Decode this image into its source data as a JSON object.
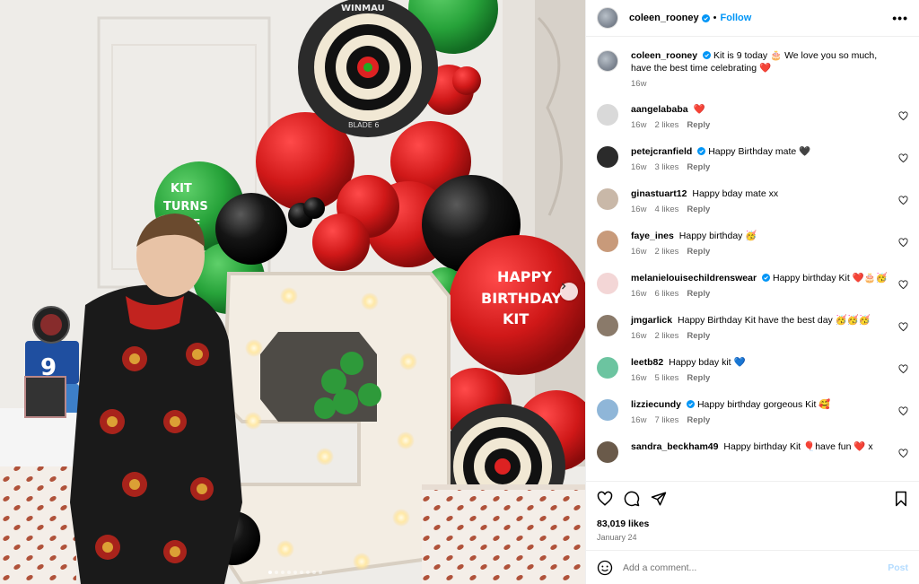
{
  "post": {
    "author": "coleen_rooney",
    "follow_label": "Follow",
    "separator": "•",
    "more_label": "•••",
    "caption_text": "Kit is 9 today 🎂 We love you so much, have the best time celebrating ❤️",
    "caption_time": "16w",
    "likes": "83,019 likes",
    "date": "January 24"
  },
  "photo": {
    "balloon_text_green": [
      "KIT",
      "TURNS",
      "NINE"
    ],
    "balloon_text_red": [
      "HAPPY",
      "BIRTHDAY",
      "KIT"
    ],
    "dartboard_brand": "WINMAU",
    "dartboard_model": "BLADE 6",
    "cake_number": "9",
    "big_number": "9",
    "carousel_dots": 9,
    "active_dot": 0
  },
  "comments": [
    {
      "user": "aangelababa",
      "verified": false,
      "text": "❤️",
      "time": "16w",
      "likes": "2 likes",
      "reply": "Reply",
      "avatar_color": "#d9d9d9"
    },
    {
      "user": "petejcranfield",
      "verified": true,
      "text": "Happy Birthday mate 🖤",
      "time": "16w",
      "likes": "3 likes",
      "reply": "Reply",
      "avatar_color": "#2b2b2b"
    },
    {
      "user": "ginastuart12",
      "verified": false,
      "text": "Happy bday mate xx",
      "time": "16w",
      "likes": "4 likes",
      "reply": "Reply",
      "avatar_color": "#c9b8a8"
    },
    {
      "user": "faye_ines",
      "verified": false,
      "text": "Happy birthday 🥳",
      "time": "16w",
      "likes": "2 likes",
      "reply": "Reply",
      "avatar_color": "#c89a7a"
    },
    {
      "user": "melanielouisechildrenswear",
      "verified": true,
      "text": "Happy birthday Kit ❤️🎂🥳",
      "time": "16w",
      "likes": "6 likes",
      "reply": "Reply",
      "avatar_color": "#f3d6d6"
    },
    {
      "user": "jmgarlick",
      "verified": false,
      "text": "Happy Birthday Kit have the best day 🥳🥳🥳",
      "time": "16w",
      "likes": "2 likes",
      "reply": "Reply",
      "avatar_color": "#8a7a6a"
    },
    {
      "user": "leetb82",
      "verified": false,
      "text": "Happy bday kit 💙",
      "time": "16w",
      "likes": "5 likes",
      "reply": "Reply",
      "avatar_color": "#6cc4a0"
    },
    {
      "user": "lizziecundy",
      "verified": true,
      "text": "Happy birthday gorgeous Kit 🥰",
      "time": "16w",
      "likes": "7 likes",
      "reply": "Reply",
      "avatar_color": "#8fb6d8"
    },
    {
      "user": "sandra_beckham49",
      "verified": false,
      "text": "Happy birthday Kit 🎈have fun ❤️ x",
      "time": "",
      "likes": "",
      "reply": "",
      "avatar_color": "#6a5a4a"
    }
  ],
  "composer": {
    "placeholder": "Add a comment...",
    "post_label": "Post"
  },
  "colors": {
    "accent": "#0095f6",
    "verified": "#0095f6",
    "muted": "#737373",
    "post_disabled": "#b3dbff"
  }
}
